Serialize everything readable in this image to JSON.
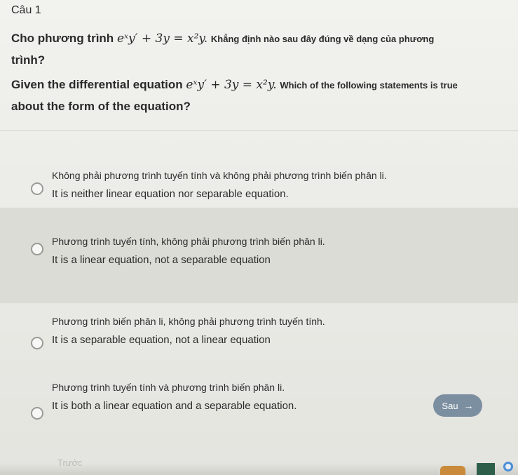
{
  "question": {
    "number_label": "Câu 1",
    "vi_before": "Cho phương trình",
    "vi_equation": "eˣy′ + 3y = x²y.",
    "vi_after": "Khẳng định nào sau đây đúng về dạng của phương",
    "vi_line2": "trình?",
    "en_before": "Given the differential equation",
    "en_equation": "eˣy′ + 3y = x²y.",
    "en_after": "Which of the following statements is true",
    "en_line2": "about the form of the equation?"
  },
  "options": [
    {
      "vi": "Không phải phương trình tuyến tính và không phải phương trình biến phân li.",
      "en": "It is neither linear equation nor separable equation."
    },
    {
      "vi": "Phương trình tuyến tính, không phải phương trình biến phân li.",
      "en": "It is a linear equation, not a separable equation"
    },
    {
      "vi": "Phương trình biến phân li, không phải phương trình tuyến tính.",
      "en": "It is a separable equation, not a linear equation"
    },
    {
      "vi": "Phương trình tuyến tính và phương trình biến phân li.",
      "en": "It is both a linear equation and a separable equation."
    }
  ],
  "navigation": {
    "next_label": "Sau",
    "next_icon": "arrow-right-icon",
    "prev_label": "Trước"
  },
  "colors": {
    "next_button": "#7c8fa0",
    "hover_row": "#dcdcd6"
  }
}
